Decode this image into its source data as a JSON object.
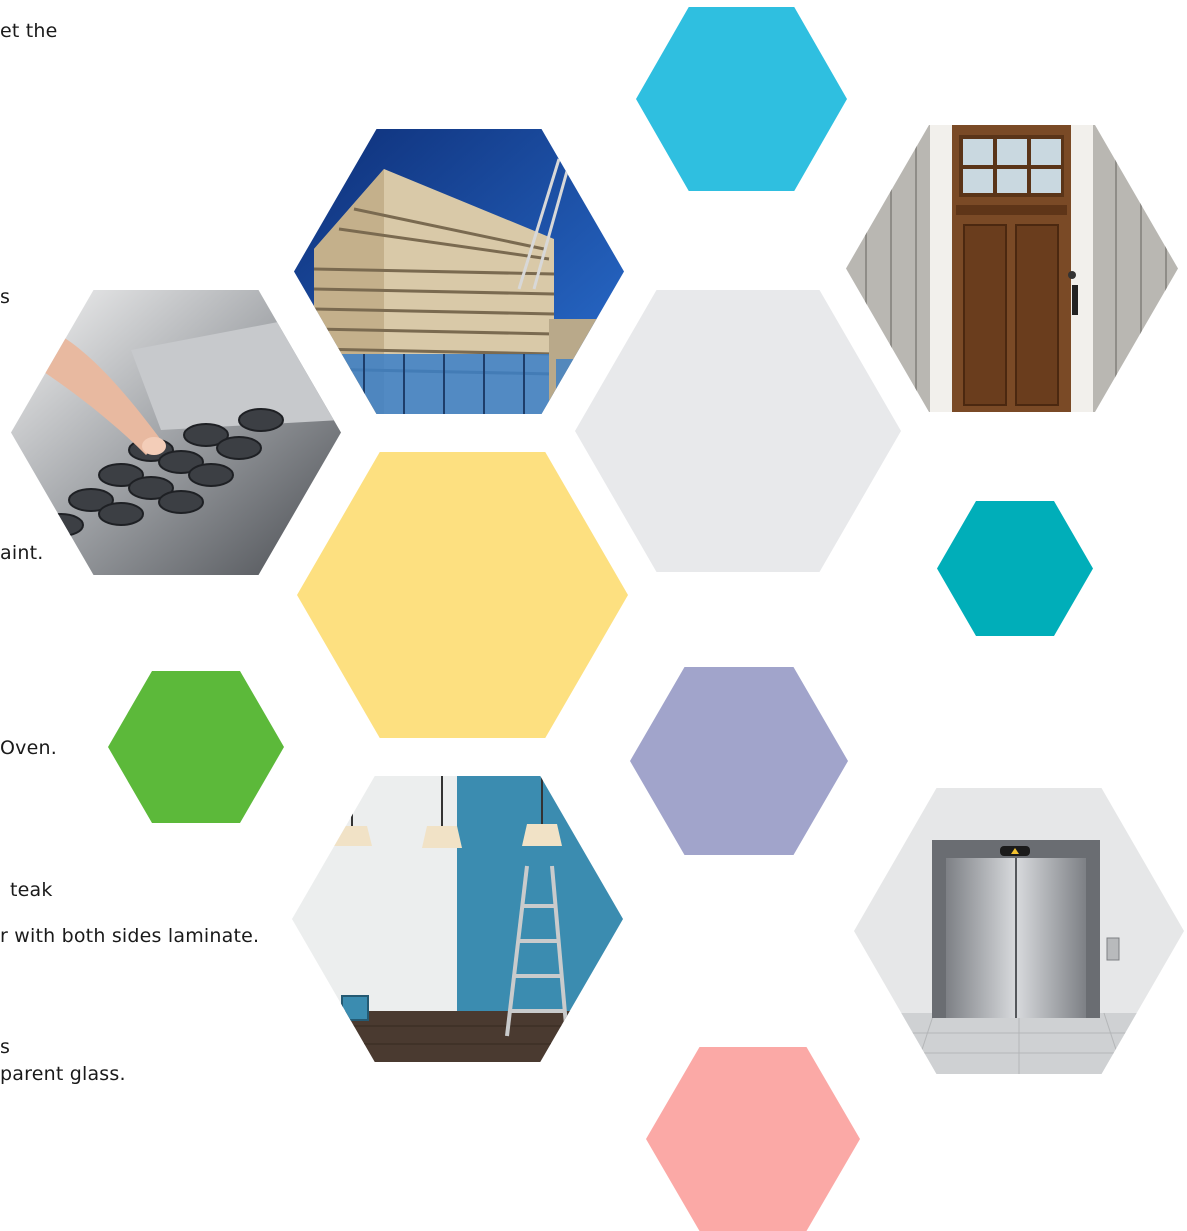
{
  "text_fragments": [
    "et the",
    "s",
    "aint.",
    "Oven.",
    "teak",
    "r with both sides laminate.",
    "s",
    "parent glass."
  ],
  "colors": {
    "sky_blue": "#2fbfe0",
    "light_gray": "#e8e9eb",
    "yellow": "#fde080",
    "teal": "#00aeb9",
    "green": "#5cb93a",
    "lavender": "#a1a4cb",
    "salmon": "#fba9a6"
  },
  "images": [
    "building-construction-photo",
    "wooden-door-photo",
    "telephone-keypad-photo",
    "painted-room-photo",
    "elevator-photo"
  ]
}
